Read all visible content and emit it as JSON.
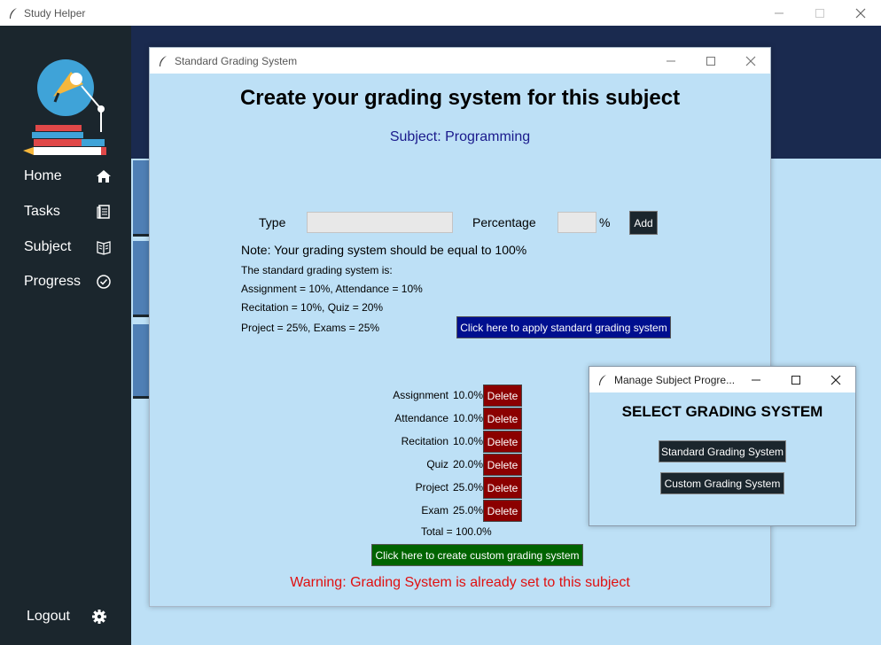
{
  "main_window": {
    "title": "Study Helper"
  },
  "sidebar": {
    "items": [
      {
        "label": "Home",
        "icon": "home-icon"
      },
      {
        "label": "Tasks",
        "icon": "tasks-icon"
      },
      {
        "label": "Subject",
        "icon": "book-icon"
      },
      {
        "label": "Progress",
        "icon": "check-circle-icon"
      }
    ],
    "logout": {
      "label": "Logout",
      "icon": "gear-icon"
    }
  },
  "standard_window": {
    "title": "Standard Grading System",
    "heading": "Create your grading system for this subject",
    "subject": "Subject: Programming",
    "type_label": "Type",
    "type_value": "",
    "percentage_label": "Percentage",
    "percentage_value": "",
    "percent_sign": "%",
    "add_label": "Add",
    "note": "Note: Your grading system should be equal to 100%",
    "standard_intro": "The standard grading system is:",
    "standard_lines": [
      "Assignment = 10%, Attendance = 10%",
      "Recitation = 10%, Quiz = 20%",
      "Project = 25%, Exams = 25%"
    ],
    "apply_label": "Click here to apply standard grading system",
    "grades": [
      {
        "name": "Assignment",
        "value": "10.0%",
        "delete": "Delete"
      },
      {
        "name": "Attendance",
        "value": "10.0%",
        "delete": "Delete"
      },
      {
        "name": "Recitation",
        "value": "10.0%",
        "delete": "Delete"
      },
      {
        "name": "Quiz",
        "value": "20.0%",
        "delete": "Delete"
      },
      {
        "name": "Project",
        "value": "25.0%",
        "delete": "Delete"
      },
      {
        "name": "Exam",
        "value": "25.0%",
        "delete": "Delete"
      }
    ],
    "total": "Total = 100.0%",
    "custom_label": "Click here to create custom grading system",
    "warning": "Warning: Grading System is already set to this subject"
  },
  "manage_window": {
    "title": "Manage Subject Progre...",
    "heading": "SELECT GRADING SYSTEM",
    "standard_button": "Standard Grading System",
    "custom_button": "Custom Grading System"
  },
  "colors": {
    "sidebar": "#1b262d",
    "panel_bg": "#bde0f6",
    "header_dark": "#1a2a4f",
    "apply_btn": "#000f8f",
    "delete_btn": "#8b0000",
    "custom_btn": "#006400",
    "warning_text": "#e01010"
  }
}
